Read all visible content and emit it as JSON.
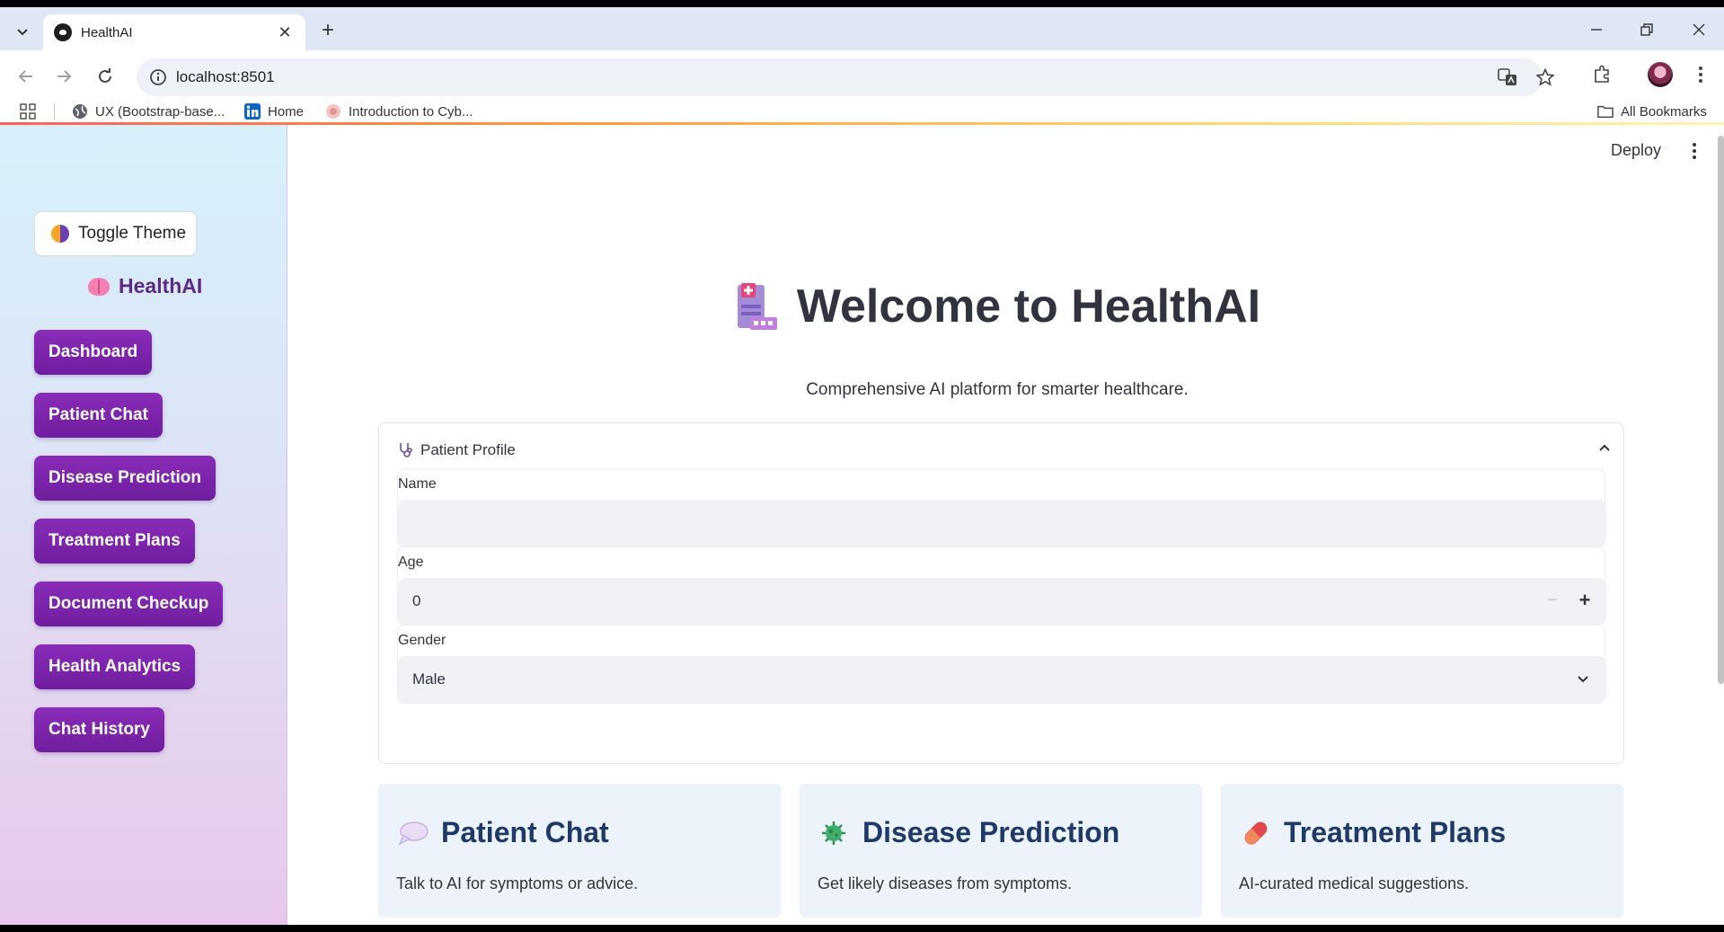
{
  "browser": {
    "tab_title": "HealthAI",
    "url": "localhost:8501",
    "bookmarks": [
      {
        "label": "UX (Bootstrap-base...",
        "icon": "globe-icon"
      },
      {
        "label": "Home",
        "icon": "linkedin-icon"
      },
      {
        "label": "Introduction to Cyb...",
        "icon": "course-icon"
      }
    ],
    "all_bookmarks_label": "All Bookmarks"
  },
  "sidebar": {
    "toggle_theme_label": "Toggle Theme",
    "brand": "HealthAI",
    "nav_items": [
      {
        "label": "Dashboard"
      },
      {
        "label": "Patient Chat"
      },
      {
        "label": "Disease Prediction"
      },
      {
        "label": "Treatment Plans"
      },
      {
        "label": "Document Checkup"
      },
      {
        "label": "Health Analytics"
      },
      {
        "label": "Chat History"
      }
    ]
  },
  "header": {
    "deploy_label": "Deploy"
  },
  "main": {
    "title": "Welcome to HealthAI",
    "subtitle": "Comprehensive AI platform for smarter healthcare.",
    "profile": {
      "header": "Patient Profile",
      "name_label": "Name",
      "name_value": "",
      "age_label": "Age",
      "age_value": "0",
      "gender_label": "Gender",
      "gender_value": "Male"
    },
    "cards": [
      {
        "title": "Patient Chat",
        "description": "Talk to AI for symptoms or advice.",
        "icon": "speech-bubble-icon"
      },
      {
        "title": "Disease Prediction",
        "description": "Get likely diseases from symptoms.",
        "icon": "microbe-icon"
      },
      {
        "title": "Treatment Plans",
        "description": "AI-curated medical suggestions.",
        "icon": "pill-icon"
      }
    ]
  },
  "colors": {
    "nav_button": "#7a24aa",
    "brand_text": "#5b2a86",
    "card_title": "#1f3a68",
    "card_bg": "#ecf3fb"
  }
}
